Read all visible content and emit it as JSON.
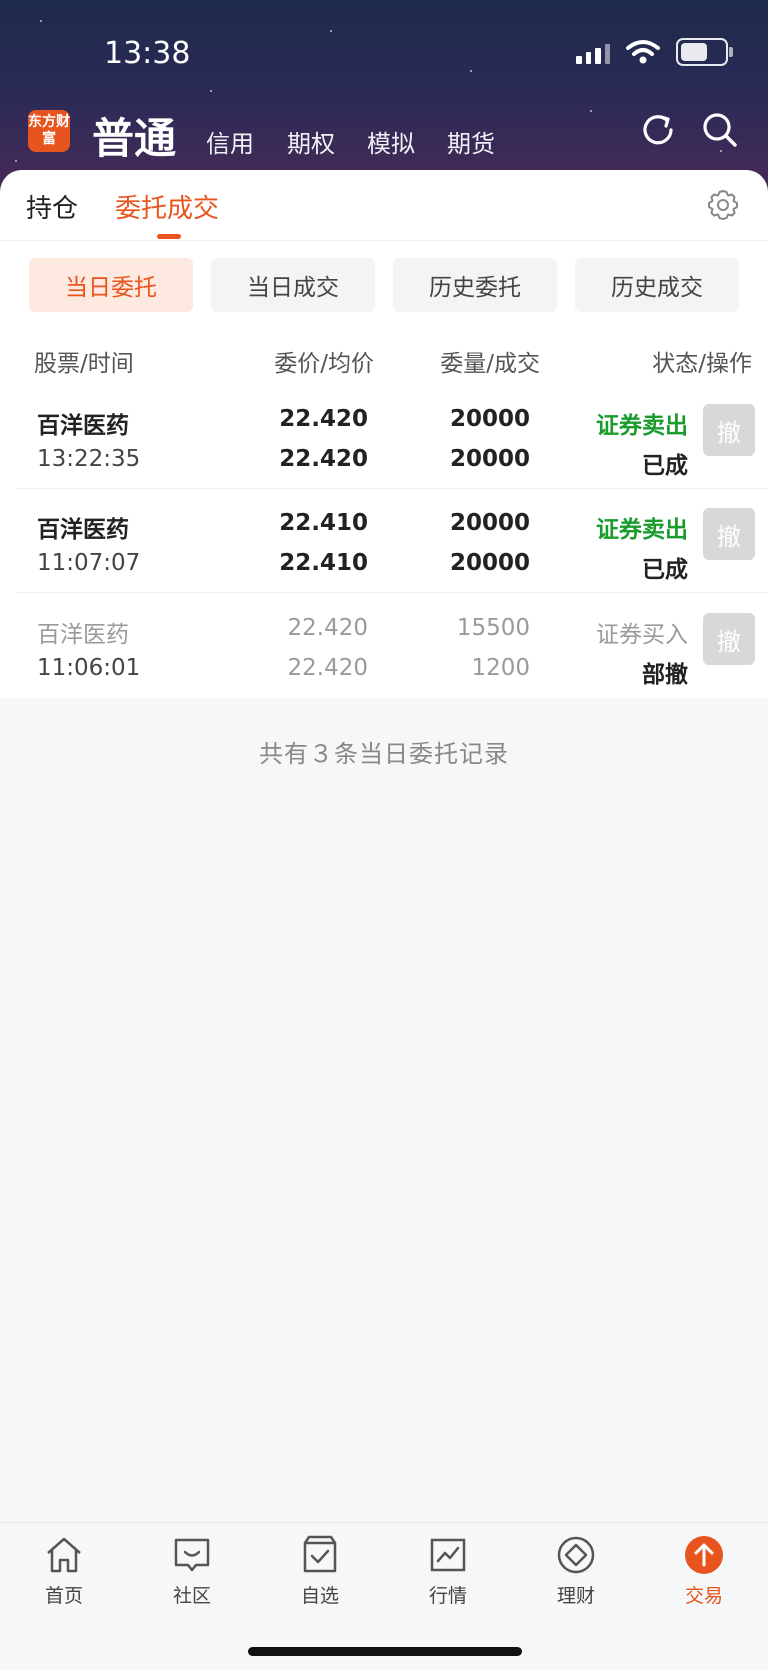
{
  "status_bar": {
    "time": "13:38"
  },
  "header": {
    "logo_text": "东方财富",
    "mode_title": "普通",
    "mode_tabs": [
      "信用",
      "期权",
      "模拟",
      "期货"
    ],
    "icons": [
      "refresh-icon",
      "search-icon"
    ]
  },
  "top_tabs": [
    {
      "label": "持仓",
      "active": false
    },
    {
      "label": "委托成交",
      "active": true
    }
  ],
  "segments": [
    {
      "label": "当日委托",
      "active": true
    },
    {
      "label": "当日成交",
      "active": false
    },
    {
      "label": "历史委托",
      "active": false
    },
    {
      "label": "历史成交",
      "active": false
    }
  ],
  "columns": [
    "股票/时间",
    "委价/均价",
    "委量/成交",
    "状态/操作"
  ],
  "orders": [
    {
      "name": "百洋医药",
      "time": "13:22:35",
      "price": "22.420",
      "avg_price": "22.420",
      "qty": "20000",
      "filled": "20000",
      "direction": "证券卖出",
      "status": "已成",
      "cancel": "撤"
    },
    {
      "name": "百洋医药",
      "time": "11:07:07",
      "price": "22.410",
      "avg_price": "22.410",
      "qty": "20000",
      "filled": "20000",
      "direction": "证券卖出",
      "status": "已成",
      "cancel": "撤"
    },
    {
      "name": "百洋医药",
      "time": "11:06:01",
      "price": "22.420",
      "avg_price": "22.420",
      "qty": "15500",
      "filled": "1200",
      "direction": "证券买入",
      "status": "部撤",
      "cancel": "撤"
    }
  ],
  "summary": "共有３条当日委托记录",
  "bottom_nav": [
    {
      "label": "首页",
      "icon": "home-icon",
      "active": false
    },
    {
      "label": "社区",
      "icon": "community-icon",
      "active": false
    },
    {
      "label": "自选",
      "icon": "watchlist-icon",
      "active": false
    },
    {
      "label": "行情",
      "icon": "market-icon",
      "active": false
    },
    {
      "label": "理财",
      "icon": "wealth-icon",
      "active": false
    },
    {
      "label": "交易",
      "icon": "trade-icon",
      "active": true
    }
  ],
  "colors": {
    "accent": "#e8541d",
    "sell": "#1a9c2c",
    "muted": "#9a9a9a"
  }
}
